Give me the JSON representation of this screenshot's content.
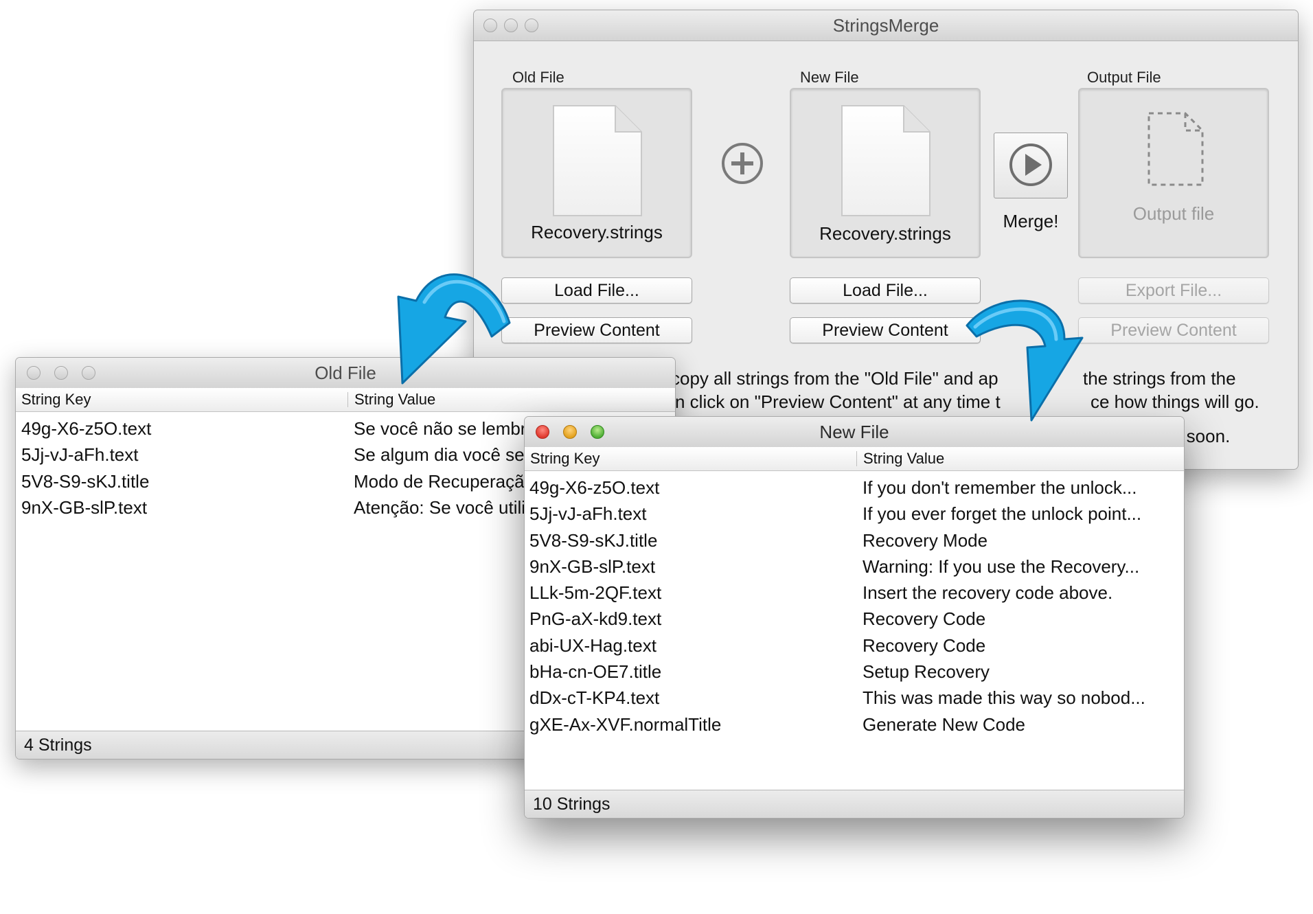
{
  "main_window": {
    "title": "StringsMerge",
    "old_file": {
      "label": "Old File",
      "filename": "Recovery.strings",
      "load_button": "Load File...",
      "preview_button": "Preview Content"
    },
    "new_file": {
      "label": "New File",
      "filename": "Recovery.strings",
      "load_button": "Load File...",
      "preview_button": "Preview Content"
    },
    "output_file": {
      "label": "Output File",
      "placeholder": "Output file",
      "export_button": "Export File...",
      "preview_button": "Preview Content"
    },
    "merge_label": "Merge!",
    "description": [
      "copy all strings from the \"Old File\" and ap",
      "the strings from the",
      "n click on \"Preview Content\" at any time t",
      "ce how things will go.",
      "d soon."
    ]
  },
  "old_window": {
    "title": "Old File",
    "columns": [
      "String Key",
      "String Value"
    ],
    "rows": [
      {
        "key": "49g-X6-z5O.text",
        "value": "Se você não se lembrar"
      },
      {
        "key": "5Jj-vJ-aFh.text",
        "value": "Se algum dia você se esquecer"
      },
      {
        "key": "5V8-S9-sKJ.title",
        "value": "Modo de Recuperação"
      },
      {
        "key": "9nX-GB-slP.text",
        "value": "Atenção: Se você utilizar"
      }
    ],
    "footer": "4 Strings"
  },
  "new_window": {
    "title": "New File",
    "columns": [
      "String Key",
      "String Value"
    ],
    "rows": [
      {
        "key": "49g-X6-z5O.text",
        "value": "If you don't remember the unlock..."
      },
      {
        "key": "5Jj-vJ-aFh.text",
        "value": "If you ever forget the unlock point..."
      },
      {
        "key": "5V8-S9-sKJ.title",
        "value": "Recovery Mode"
      },
      {
        "key": "9nX-GB-slP.text",
        "value": "Warning: If you use the Recovery..."
      },
      {
        "key": "LLk-5m-2QF.text",
        "value": "Insert the recovery code above."
      },
      {
        "key": "PnG-aX-kd9.text",
        "value": "Recovery Code"
      },
      {
        "key": "abi-UX-Hag.text",
        "value": "Recovery Code"
      },
      {
        "key": "bHa-cn-OE7.title",
        "value": "Setup Recovery"
      },
      {
        "key": "dDx-cT-KP4.text",
        "value": "This was made this way so nobod..."
      },
      {
        "key": "gXE-Ax-XVF.normalTitle",
        "value": "Generate New Code"
      }
    ],
    "footer": "10 Strings"
  },
  "colors": {
    "arrow": "#16a6e4",
    "arrow_edge": "#0b6fa9"
  }
}
